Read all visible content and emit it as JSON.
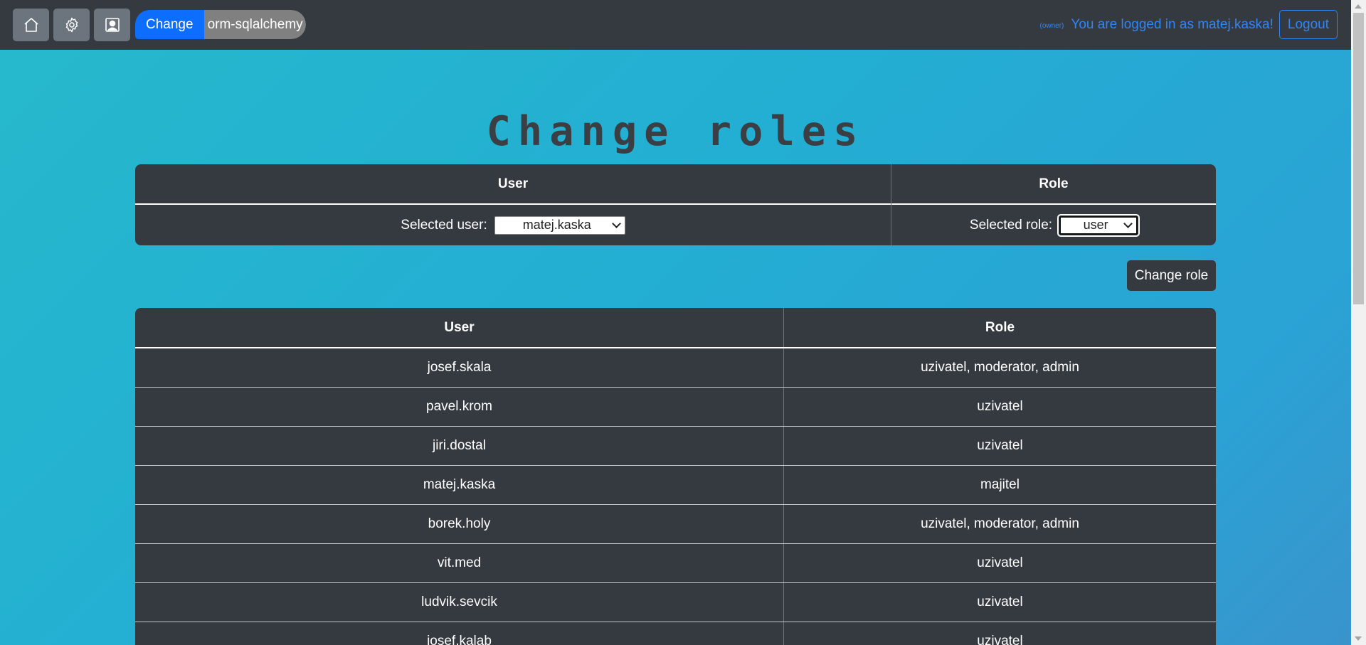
{
  "nav": {
    "icons": [
      "home-icon",
      "gear-icon",
      "user-profile-icon"
    ],
    "toggle_change": "Change",
    "toggle_db": "orm-sqlalchemy",
    "owner_tag": "(owner)",
    "login_text": "You are logged in as matej.kaska!",
    "logout": "Logout"
  },
  "page": {
    "title": "Change roles"
  },
  "selection": {
    "user_header": "User",
    "role_header": "Role",
    "user_label": "Selected user:",
    "user_value": "matej.kaska",
    "role_label": "Selected role:",
    "role_value": "user"
  },
  "actions": {
    "change_role": "Change role"
  },
  "users_table": {
    "headers": [
      "User",
      "Role"
    ],
    "rows": [
      {
        "user": "josef.skala",
        "role": "uzivatel, moderator, admin"
      },
      {
        "user": "pavel.krom",
        "role": "uzivatel"
      },
      {
        "user": "jiri.dostal",
        "role": "uzivatel"
      },
      {
        "user": "matej.kaska",
        "role": "majitel"
      },
      {
        "user": "borek.holy",
        "role": "uzivatel, moderator, admin"
      },
      {
        "user": "vit.med",
        "role": "uzivatel"
      },
      {
        "user": "ludvik.sevcik",
        "role": "uzivatel"
      },
      {
        "user": "josef.kalab",
        "role": "uzivatel"
      }
    ]
  },
  "colors": {
    "navbar": "#343a40",
    "nav_button": "#6c757d",
    "primary": "#0d6efd",
    "link": "#2f86f6",
    "table": "#343a40"
  }
}
